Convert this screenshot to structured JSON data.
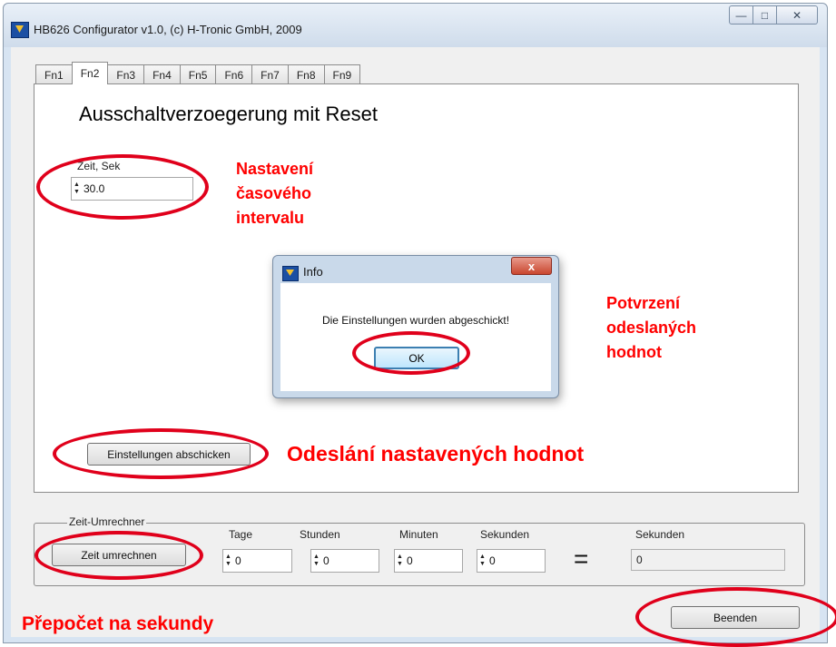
{
  "window": {
    "title": "HB626 Configurator v1.0, (c) H-Tronic GmbH, 2009",
    "min_glyph": "—",
    "max_glyph": "□",
    "close_glyph": "✕"
  },
  "tabs": [
    {
      "label": "Fn1",
      "active": false
    },
    {
      "label": "Fn2",
      "active": true
    },
    {
      "label": "Fn3",
      "active": false
    },
    {
      "label": "Fn4",
      "active": false
    },
    {
      "label": "Fn5",
      "active": false
    },
    {
      "label": "Fn6",
      "active": false
    },
    {
      "label": "Fn7",
      "active": false
    },
    {
      "label": "Fn8",
      "active": false
    },
    {
      "label": "Fn9",
      "active": false
    }
  ],
  "panel": {
    "title": "Ausschaltverzoegerung mit Reset",
    "zeit_label": "Zeit, Sek",
    "zeit_value": "30.0",
    "send_button": "Einstellungen abschicken"
  },
  "converter": {
    "group_label": "Zeit-Umrechner",
    "convert_button": "Zeit umrechnen",
    "tage_label": "Tage",
    "tage_value": "0",
    "stunden_label": "Stunden",
    "stunden_value": "0",
    "minuten_label": "Minuten",
    "minuten_value": "0",
    "sekunden_label": "Sekunden",
    "sekunden_value": "0",
    "equals": "=",
    "result_label": "Sekunden",
    "result_value": "0"
  },
  "quit_button": "Beenden",
  "dialog": {
    "title": "Info",
    "message": "Die Einstellungen wurden abgeschickt!",
    "ok": "OK",
    "close_glyph": "x"
  },
  "annotations": {
    "interval_line1": "Nastavení",
    "interval_line2": "časového",
    "interval_line3": "intervalu",
    "confirm_line1": "Potvrzení",
    "confirm_line2": "odeslaných",
    "confirm_line3": "hodnot",
    "send": "Odeslání nastavených hodnot",
    "convert": "Přepočet na sekundy",
    "color": "#ff0000"
  },
  "spin_arrows": {
    "up": "▲",
    "down": "▼"
  }
}
